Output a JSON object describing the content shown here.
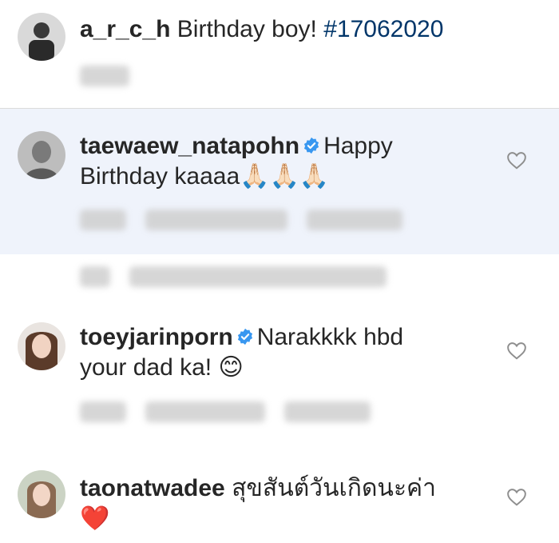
{
  "caption": {
    "username": "a_r_c_h",
    "text": "Birthday boy!",
    "hashtag": "#17062020"
  },
  "comments": [
    {
      "username": "taewaew_natapohn",
      "verified": true,
      "text_line1": "Happy",
      "text_line2": "Birthday kaaaa",
      "emoji": "🙏🏻🙏🏻🙏🏻"
    },
    {
      "username": "toeyjarinporn",
      "verified": true,
      "text_line1": "Narakkkk hbd",
      "text_line2": "your dad ka!",
      "emoji": "😊"
    },
    {
      "username": "taonatwadee",
      "verified": false,
      "text_line1": "สุขสันต์วันเกิดนะค่า",
      "emoji": "❤️"
    }
  ],
  "icons": {
    "heart": "heart-outline-icon",
    "verified": "verified-badge-icon"
  },
  "colors": {
    "text": "#262626",
    "hashtag": "#003569",
    "highlight_bg": "#eff3fb",
    "verified": "#3897f0",
    "heart_outline": "#8e8e8e",
    "red_heart": "#e8231f"
  }
}
